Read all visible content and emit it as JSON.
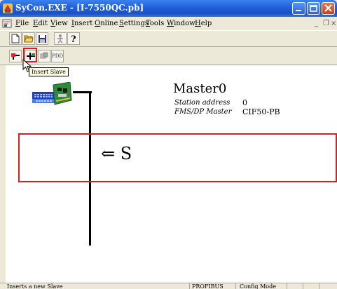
{
  "window": {
    "title": "SyCon.EXE - [I-7550QC.pb]"
  },
  "menu": {
    "items": [
      "File",
      "Edit",
      "View",
      "Insert",
      "Online",
      "Settings",
      "Tools",
      "Window",
      "Help"
    ],
    "mdi_min": "_",
    "mdi_restore": "❐",
    "mdi_close": "×"
  },
  "toolbar2": {
    "pdd_label": "PDD"
  },
  "tooltip": {
    "text": "Insert Slave"
  },
  "master": {
    "name": "Master0",
    "station_address_label": "Station address",
    "station_address_value": "0",
    "type_label": "FMS/DP Master",
    "type_value": "CIF50-PB"
  },
  "annotation": {
    "text": "⇐ S"
  },
  "status": {
    "message": "Inserts a new Slave",
    "bus": "PROFIBUS",
    "mode": "Config Mode"
  },
  "colors": {
    "highlight": "#d42020",
    "titlebar": "#1f5fd8",
    "tooltip_bg": "#ffffe1"
  }
}
